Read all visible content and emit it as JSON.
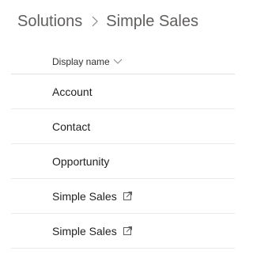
{
  "breadcrumb": {
    "root": "Solutions",
    "separator_icon": "chevron-right-icon",
    "current": "Simple Sales"
  },
  "table": {
    "column_header": "Display name",
    "sort_icon": "chevron-down-icon",
    "rows": [
      {
        "label": "Account",
        "external_link": false
      },
      {
        "label": "Contact",
        "external_link": false
      },
      {
        "label": "Opportunity",
        "external_link": false
      },
      {
        "label": "Simple Sales",
        "external_link": true
      },
      {
        "label": "Simple Sales",
        "external_link": true
      }
    ]
  },
  "colors": {
    "breadcrumb_text": "#605e5c",
    "text": "#201f1e",
    "divider": "#edebe9"
  }
}
